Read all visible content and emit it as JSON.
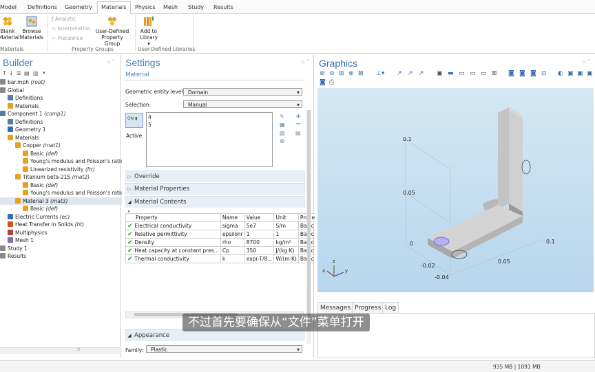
{
  "ribbon_tabs": [
    "Model",
    "Definitions",
    "Geometry",
    "Materials",
    "Physics",
    "Mesh",
    "Study",
    "Results"
  ],
  "ribbon": {
    "blank_material": [
      "Blank",
      "Material"
    ],
    "browse_materials": [
      "Browse",
      "Materials"
    ],
    "analytic": "Analytic",
    "interpolation": "Interpolation",
    "piecewise": "Piecewise",
    "user_defined_property_group": [
      "User-Defined",
      "Property Group"
    ],
    "add_to_library": [
      "Add to",
      "Library ▾"
    ],
    "group_materials": "Materials",
    "group_property_groups": "Property Groups",
    "group_udl": "User-Defined Libraries"
  },
  "builder": {
    "title": "Builder",
    "tree": [
      {
        "label": "bar.mph",
        "tag": "(root)",
        "indent": 0
      },
      {
        "label": "Global",
        "tag": "",
        "indent": 0
      },
      {
        "label": "Definitions",
        "tag": "",
        "indent": 1
      },
      {
        "label": "Materials",
        "tag": "",
        "indent": 1
      },
      {
        "label": "Component 1",
        "tag": "(comp1)",
        "indent": 0
      },
      {
        "label": "Definitions",
        "tag": "",
        "indent": 1
      },
      {
        "label": "Geometry 1",
        "tag": "",
        "indent": 1
      },
      {
        "label": "Materials",
        "tag": "",
        "indent": 1
      },
      {
        "label": "Copper",
        "tag": "(mat1)",
        "indent": 2
      },
      {
        "label": "Basic",
        "tag": "(def)",
        "indent": 3
      },
      {
        "label": "Young's modulus and Poisson's ratio",
        "tag": "(E",
        "indent": 3
      },
      {
        "label": "Linearized resistivity",
        "tag": "(ltr)",
        "indent": 3
      },
      {
        "label": "Titanium beta-21S",
        "tag": "(mat2)",
        "indent": 2
      },
      {
        "label": "Basic",
        "tag": "(def)",
        "indent": 3
      },
      {
        "label": "Young's modulus and Poisson's ratio",
        "tag": "(E",
        "indent": 3
      },
      {
        "label": "Material 3",
        "tag": "(mat3)",
        "indent": 2
      },
      {
        "label": "Basic",
        "tag": "(def)",
        "indent": 3
      },
      {
        "label": "Electric Currents",
        "tag": "(ec)",
        "indent": 1
      },
      {
        "label": "Heat Transfer in Solids",
        "tag": "(ht)",
        "indent": 1
      },
      {
        "label": "Multiphysics",
        "tag": "",
        "indent": 1
      },
      {
        "label": "Mesh 1",
        "tag": "",
        "indent": 1
      },
      {
        "label": "Study 1",
        "tag": "",
        "indent": 0
      },
      {
        "label": "Results",
        "tag": "",
        "indent": 0
      }
    ],
    "scroll_thumb": "⦙⦙⦙"
  },
  "settings": {
    "title": "Settings",
    "subtitle": "Material",
    "entity_level_label": "Geometric entity level:",
    "entity_level_value": "Domain",
    "selection_label": "Selection:",
    "selection_value": "Manual",
    "selection_items": [
      "4",
      "5"
    ],
    "active_label": "Active",
    "sections": {
      "override": "Override",
      "material_properties": "Material Properties",
      "material_contents": "Material Contents",
      "appearance": "Appearance"
    },
    "table_headers": [
      "Property",
      "Name",
      "Value",
      "Unit",
      "Prope"
    ],
    "table_rows": [
      [
        "Electrical conductivity",
        "sigma",
        "5e7",
        "S/m",
        "Basic"
      ],
      [
        "Relative permittivity",
        "epsilonr",
        "1",
        "1",
        "Basic"
      ],
      [
        "Density",
        "rho",
        "8700",
        "kg/m³",
        "Basic"
      ],
      [
        "Heat capacity at constant pres...",
        "Cp",
        "350",
        "J/(kg·K)",
        "Basic"
      ],
      [
        "Thermal conductivity",
        "k",
        "exp(-T/8...",
        "W/(m·K)",
        "Basic"
      ]
    ],
    "family_label": "Family:",
    "family_value": "Plastic"
  },
  "graphics": {
    "title": "Graphics",
    "axis_labels": [
      "0.1",
      "0.05",
      "0",
      "-0.02",
      "-0.04",
      "0.05",
      "0.1"
    ],
    "axes": {
      "x": "x",
      "y": "y",
      "z": "z"
    },
    "tabs": [
      "Messages",
      "Progress",
      "Log"
    ]
  },
  "subtitle_text": "不过首先要确保从“文件”菜单打开",
  "status": {
    "memory": "935 MB | 1091 MB"
  },
  "colors": {
    "accent": "#4a7fb5",
    "selected_domain": "#b6b0f0",
    "check": "#2e9a3a"
  }
}
